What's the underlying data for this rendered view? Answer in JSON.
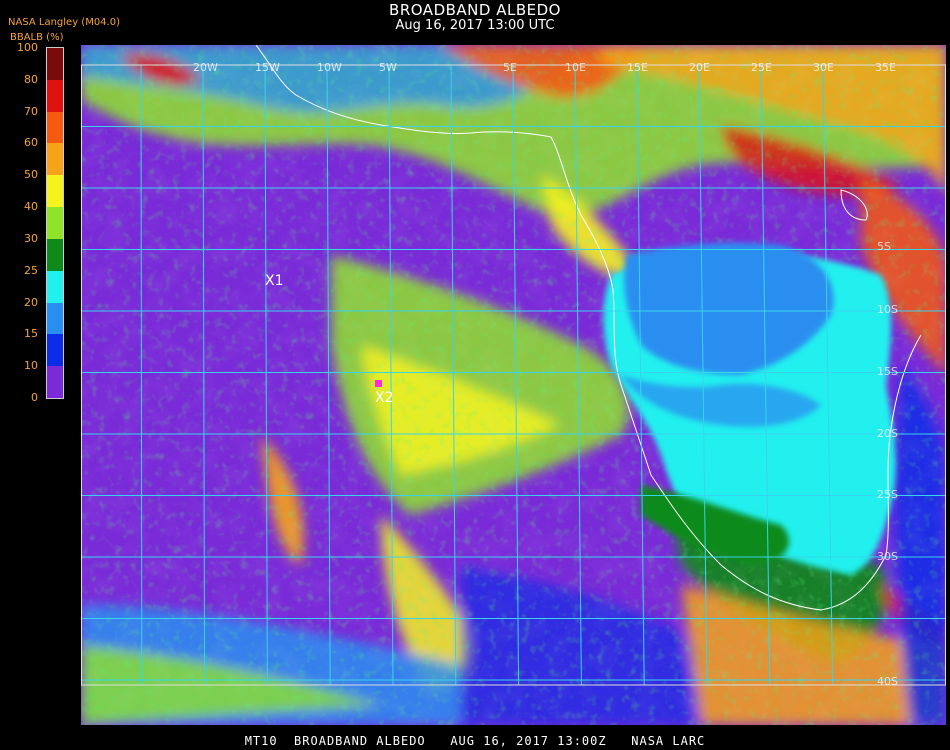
{
  "header": {
    "title": "BROADBAND ALBEDO",
    "subtitle": "Aug 16, 2017 13:00 UTC",
    "credit": "NASA Langley (M04.0)"
  },
  "colorbar": {
    "label": "BBALB (%)",
    "ticks": [
      "100",
      "80",
      "70",
      "60",
      "50",
      "40",
      "30",
      "25",
      "20",
      "15",
      "10",
      "0"
    ],
    "bands": [
      {
        "min": 80,
        "max": 100,
        "color": "#7b0b0b"
      },
      {
        "min": 70,
        "max": 80,
        "color": "#e0120f"
      },
      {
        "min": 60,
        "max": 70,
        "color": "#f55a12"
      },
      {
        "min": 50,
        "max": 60,
        "color": "#f5a318"
      },
      {
        "min": 40,
        "max": 50,
        "color": "#f5f31e"
      },
      {
        "min": 30,
        "max": 40,
        "color": "#8fe42a"
      },
      {
        "min": 25,
        "max": 30,
        "color": "#0d8a1a"
      },
      {
        "min": 20,
        "max": 25,
        "color": "#22f0ee"
      },
      {
        "min": 15,
        "max": 20,
        "color": "#2a8ef0"
      },
      {
        "min": 10,
        "max": 15,
        "color": "#0a2de8"
      },
      {
        "min": 0,
        "max": 10,
        "color": "#7a2bd8"
      }
    ]
  },
  "map": {
    "graticule_color": "#38d4ec",
    "coast_color": "#ffffff",
    "top_lon_labels": [
      "20W",
      "15W",
      "10W",
      "5W",
      "5E",
      "10E",
      "15E",
      "20E",
      "25E",
      "30E",
      "35E"
    ],
    "right_lat_labels": [
      "5S",
      "10S",
      "15S",
      "20S",
      "25S",
      "30S",
      "40S"
    ],
    "markers": [
      {
        "label": "X1",
        "color": "#ffffff"
      },
      {
        "label": "X2",
        "color": "#ffffff",
        "point_color": "#ff2bd6"
      }
    ]
  },
  "footer": {
    "text": "MT10  BROADBAND ALBEDO   AUG 16, 2017 13:00Z   NASA LARC"
  }
}
